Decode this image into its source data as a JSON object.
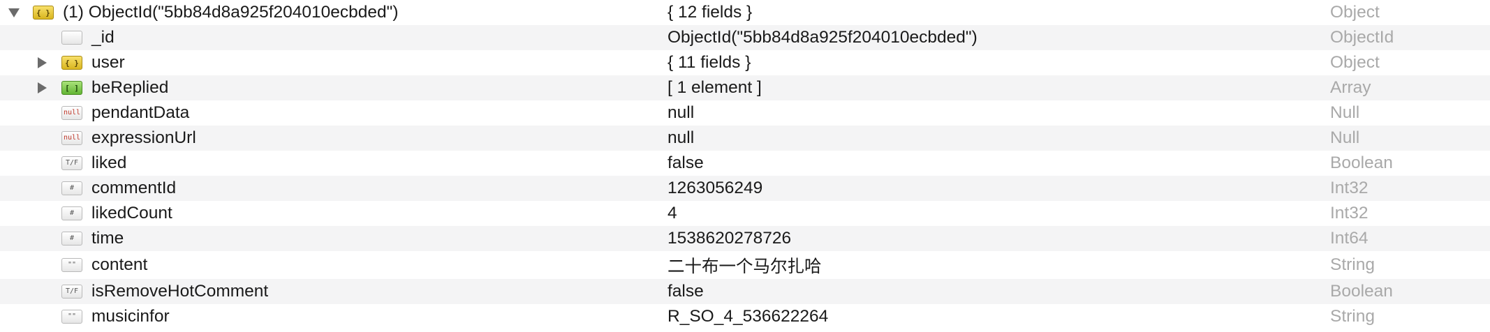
{
  "rows": [
    {
      "key": "(1) ObjectId(\"5bb84d8a925f204010ecbded\")",
      "value": "{ 12 fields }",
      "type": "Object",
      "icon": "object-icon",
      "glyph": "{ }"
    },
    {
      "key": "_id",
      "value": "ObjectId(\"5bb84d8a925f204010ecbded\")",
      "type": "ObjectId",
      "icon": "objectid-icon",
      "glyph": ""
    },
    {
      "key": "user",
      "value": "{ 11 fields }",
      "type": "Object",
      "icon": "object-icon",
      "glyph": "{ }"
    },
    {
      "key": "beReplied",
      "value": "[ 1 element ]",
      "type": "Array",
      "icon": "array-icon",
      "glyph": "[ ]"
    },
    {
      "key": "pendantData",
      "value": "null",
      "type": "Null",
      "icon": "null-icon",
      "glyph": "null"
    },
    {
      "key": "expressionUrl",
      "value": "null",
      "type": "Null",
      "icon": "null-icon",
      "glyph": "null"
    },
    {
      "key": "liked",
      "value": "false",
      "type": "Boolean",
      "icon": "boolean-icon",
      "glyph": "T/F"
    },
    {
      "key": "commentId",
      "value": "1263056249",
      "type": "Int32",
      "icon": "number-icon",
      "glyph": "#"
    },
    {
      "key": "likedCount",
      "value": "4",
      "type": "Int32",
      "icon": "number-icon",
      "glyph": "#"
    },
    {
      "key": "time",
      "value": "1538620278726",
      "type": "Int64",
      "icon": "number-icon",
      "glyph": "#"
    },
    {
      "key": "content",
      "value": "二十布一个马尔扎哈",
      "type": "String",
      "icon": "string-icon",
      "glyph": "\"\""
    },
    {
      "key": "isRemoveHotComment",
      "value": "false",
      "type": "Boolean",
      "icon": "boolean-icon",
      "glyph": "T/F"
    },
    {
      "key": "musicinfor",
      "value": "R_SO_4_536622264",
      "type": "String",
      "icon": "string-icon",
      "glyph": "\"\""
    }
  ]
}
